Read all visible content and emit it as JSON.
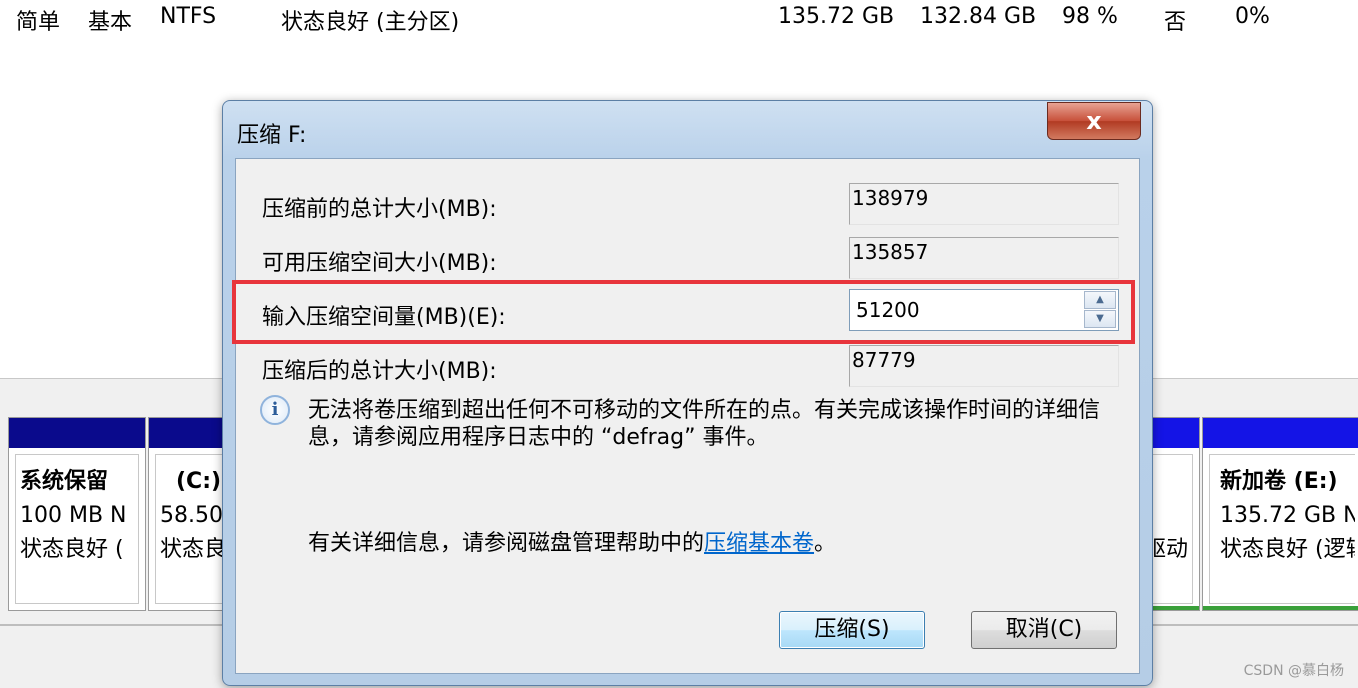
{
  "volume_row": {
    "layout": "简单",
    "type": "基本",
    "fs": "NTFS",
    "status": "状态良好 (主分区)",
    "capacity": "135.72 GB",
    "free": "132.84 GB",
    "free_pct": "98 %",
    "fault_tolerance": "否",
    "overhead": "0%"
  },
  "partitions": {
    "system_reserved": {
      "title": "系统保留",
      "size": "100 MB N",
      "status": "状态良好 ("
    },
    "c_drive": {
      "title": "(C:)",
      "size": "58.50",
      "status": "状态良"
    },
    "hidden_partial_status": "驱动",
    "e_drive": {
      "title": "新加卷  (E:)",
      "size": "135.72 GB N",
      "status": "状态良好 (逻辑"
    }
  },
  "dialog": {
    "title": "压缩 F:",
    "close_label": "x",
    "fields": {
      "total_before_label": "压缩前的总计大小(MB):",
      "total_before_value": "138979",
      "available_label": "可用压缩空间大小(MB):",
      "available_value": "135857",
      "input_label": "输入压缩空间量(MB)(E):",
      "input_value": "51200",
      "total_after_label": "压缩后的总计大小(MB):",
      "total_after_value": "87779"
    },
    "info_text": "无法将卷压缩到超出任何不可移动的文件所在的点。有关完成该操作时间的详细信息，请参阅应用程序日志中的 “defrag” 事件。",
    "help_prefix": "有关详细信息，请参阅磁盘管理帮助中的",
    "help_link": "压缩基本卷",
    "help_suffix": "。",
    "shrink_button": "压缩(S)",
    "cancel_button": "取消(C)"
  },
  "watermark": "CSDN @慕白杨",
  "colors": {
    "highlight": "#e8353c",
    "link": "#0066cc",
    "partition_bar_dark": "#0a0a8c",
    "partition_bar_blue": "#1414e6"
  }
}
